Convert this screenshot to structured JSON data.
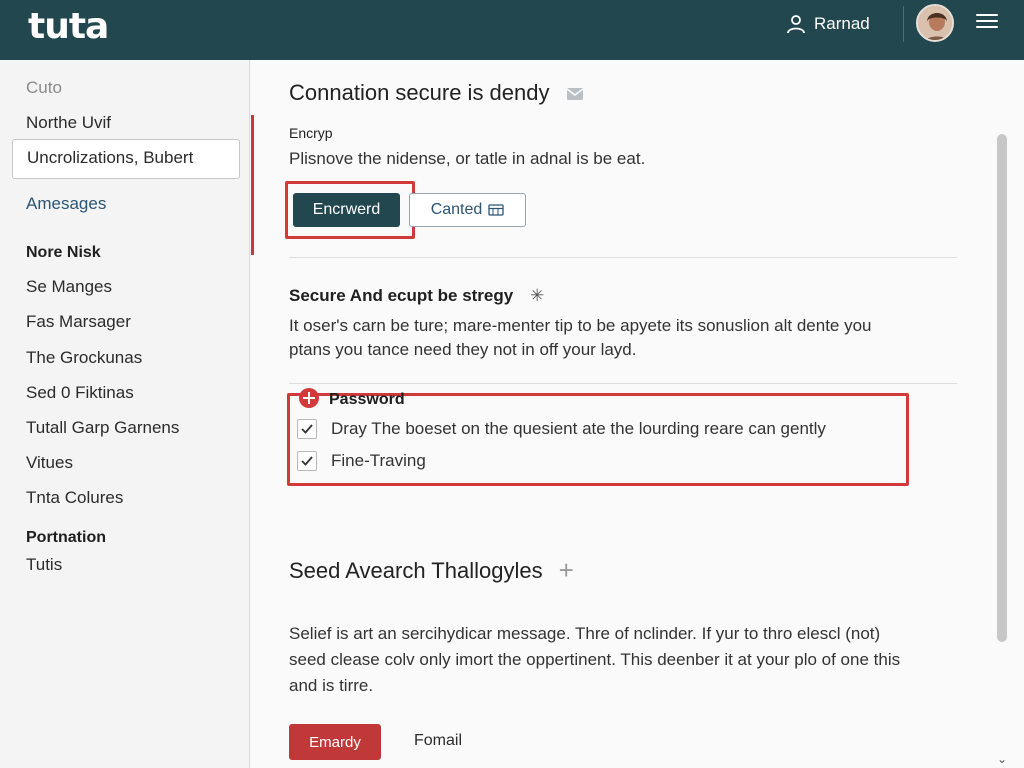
{
  "header": {
    "logo": "tuta",
    "user_name": "Rarnad"
  },
  "sidebar": {
    "items": [
      {
        "label": "Cuto"
      },
      {
        "label": "Northe Uvif"
      },
      {
        "label": "Uncrolizations, Bubert"
      },
      {
        "label": "Amesages"
      },
      {
        "label": "Nore Nisk"
      },
      {
        "label": "Se Manges"
      },
      {
        "label": "Fas Marsager"
      },
      {
        "label": "The Grockunas"
      },
      {
        "label": "Sed 0 Fiktinas"
      },
      {
        "label": "Tutall Garp Garnens"
      },
      {
        "label": "Vitues"
      },
      {
        "label": "Tnta Colures"
      },
      {
        "label": "Portnation"
      },
      {
        "label": "Tutis"
      }
    ]
  },
  "main": {
    "title": "Connation secure is dendy",
    "sub_label": "Encryp",
    "description": "Plisnove the nidense, or tatle in adnal is be eat.",
    "primary_button": "Encrwerd",
    "secondary_button": "Canted",
    "section_title": "Secure And ecupt be stregy",
    "section_text_1": "It oser's carn be ture; mare-menter tip to be apyete its sonuslion alt dente you",
    "section_text_2": "ptans you tance need they not in off your layd.",
    "password_label": "Password",
    "checks": [
      {
        "label": "Dray The boeset on the quesient ate the lourding reare can gently"
      },
      {
        "label": "Fine-Traving"
      }
    ],
    "section2_title": "Seed Avearch Thallogyles",
    "section2_text_1": "Selief is art an sercihydicar message. Thre of nclinder. If yur to thro elescl (not)",
    "section2_text_2": "seed clease colv only imort the oppertinent. This deenber it at your plo of one this",
    "section2_text_3": "and is tirre.",
    "red_button": "Emardy",
    "link_button": "Fomail"
  },
  "colors": {
    "header_bg": "#22474f",
    "primary": "#22474f",
    "highlight": "#d13a3a",
    "danger_button": "#c13838",
    "link_accent": "#2a5576"
  },
  "icons": [
    "user-icon",
    "avatar",
    "hamburger-menu-icon",
    "mail-icon",
    "calendar-icon",
    "sparkle-icon",
    "plus-icon",
    "check-icon",
    "chevron-down-icon"
  ]
}
